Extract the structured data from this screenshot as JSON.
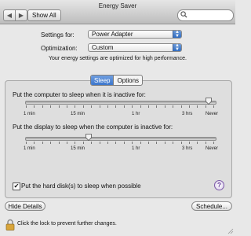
{
  "window": {
    "title": "Energy Saver"
  },
  "toolbar": {
    "back_label": "◀",
    "forward_label": "▶",
    "show_all_label": "Show All",
    "search_placeholder": ""
  },
  "settings_for": {
    "label": "Settings for:",
    "value": "Power Adapter"
  },
  "optimization": {
    "label": "Optimization:",
    "value": "Custom"
  },
  "note": "Your energy settings are optimized for high performance.",
  "tabs": [
    {
      "label": "Sleep",
      "active": true
    },
    {
      "label": "Options",
      "active": false
    }
  ],
  "computer_sleep": {
    "label": "Put the computer to sleep when it is inactive for:",
    "value": "Never",
    "ticks": [
      "1 min",
      "15 min",
      "1 hr",
      "3 hrs",
      "Never"
    ]
  },
  "display_sleep": {
    "label": "Put the display to sleep when the computer is inactive for:",
    "value": "15 min",
    "ticks": [
      "1 min",
      "15 min",
      "1 hr",
      "3 hrs",
      "Never"
    ]
  },
  "hard_disk": {
    "label": "Put the hard disk(s) to sleep when possible",
    "checked": true
  },
  "help_label": "?",
  "buttons": {
    "hide_details": "Hide Details",
    "schedule": "Schedule..."
  },
  "lock": {
    "label": "Click the lock to prevent further changes."
  },
  "colors": {
    "accent": "#3c76cc",
    "window_bg": "#e8e8e8",
    "panel_bg": "#dedede"
  }
}
